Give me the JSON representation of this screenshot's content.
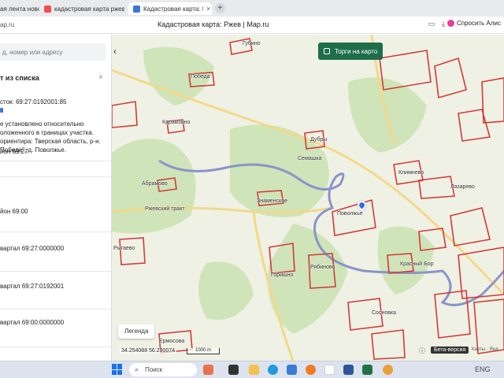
{
  "browser": {
    "tabs": [
      {
        "label": "ая лента новостей",
        "active": false,
        "icon": "news-icon",
        "color": "#e8e8e8"
      },
      {
        "label": "кадастровая карта ржев",
        "active": false,
        "icon": "yandex-icon",
        "color": "#f04c4c"
      },
      {
        "label": "Кадастровая карта: Рж",
        "active": true,
        "icon": "map-site-icon",
        "color": "#3b76e0"
      }
    ],
    "close_glyph": "×",
    "new_tab_glyph": "+",
    "address_host": "ap.ru",
    "page_title": "Кадастровая карта: Ржев | Map.ru",
    "ask_label": "Спросить Алис"
  },
  "sidebar": {
    "search_placeholder": "д, номер или адресу",
    "list_title": "т из списка",
    "close_glyph": "×",
    "items": [
      {
        "lines": [
          "сток: 69:27:0192001:85"
        ]
      },
      {
        "lines": [
          "е установлено относительно",
          "оложенного в границах участка.",
          "ориентира: Тверская область, р-н.",
          "Победа\", д. Поволжье."
        ]
      },
      {
        "lines": [
          "йон 69:27"
        ]
      },
      {
        "lines": [
          "йон 69:00"
        ]
      },
      {
        "lines": [
          "вартал 69:27:0000000"
        ]
      },
      {
        "lines": [
          "вартал 69:27:0192001"
        ]
      },
      {
        "lines": [
          "вартал 69:00:0000000"
        ]
      }
    ]
  },
  "map": {
    "auction_label": "Торги на карто",
    "legend_label": "Легенда",
    "coords": "34.254088  56.290074",
    "scale_label": "1000 m",
    "beta_label": "Бета-версия",
    "attribution": "Карты · Янд",
    "places": [
      "Губино",
      "Победа",
      "Карамзино",
      "Дубры",
      "Семашка",
      "Абрамово",
      "Знаменское",
      "Поволжье",
      "Климнево",
      "Лазарево",
      "Ржевский тракт",
      "Рыгаево",
      "Горишно",
      "Рябиново",
      "Сосновка",
      "Красный Бор",
      "Ермосова"
    ],
    "colors": {
      "river": "#8a94c8",
      "parcel": "#d23a3a",
      "forest": "#cfe4b8",
      "road": "#f2d98a"
    }
  },
  "taskbar": {
    "search_label": "Поиск",
    "apps": [
      "files-icon",
      "task-view-icon",
      "explorer-icon",
      "edge-icon",
      "store-icon",
      "firefox-icon",
      "yandex-browser-icon",
      "word-icon",
      "excel-icon",
      "mail-icon"
    ],
    "tray": "ENG"
  }
}
